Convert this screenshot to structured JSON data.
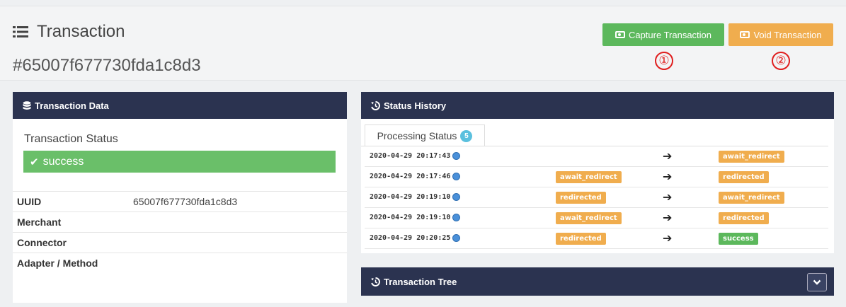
{
  "header": {
    "title": "Transaction",
    "transaction_id": "#65007f677730fda1c8d3",
    "capture_label": "Capture Transaction",
    "void_label": "Void Transaction",
    "marker_1": "①",
    "marker_2": "②"
  },
  "transaction_data": {
    "panel_title": "Transaction Data",
    "status_label": "Transaction Status",
    "status_value": "success",
    "fields": [
      {
        "key": "UUID",
        "value": "65007f677730fda1c8d3"
      },
      {
        "key": "Merchant",
        "value": ""
      },
      {
        "key": "Connector",
        "value": ""
      },
      {
        "key": "Adapter / Method",
        "value": ""
      }
    ]
  },
  "status_history": {
    "panel_title": "Status History",
    "tab_label": "Processing Status",
    "tab_count": "5",
    "rows": [
      {
        "time": "2020-04-29 20:17:43",
        "from": "",
        "to": "await_redirect"
      },
      {
        "time": "2020-04-29 20:17:46",
        "from": "await_redirect",
        "to": "redirected"
      },
      {
        "time": "2020-04-29 20:19:10",
        "from": "redirected",
        "to": "await_redirect"
      },
      {
        "time": "2020-04-29 20:19:10",
        "from": "await_redirect",
        "to": "redirected"
      },
      {
        "time": "2020-04-29 20:20:25",
        "from": "redirected",
        "to": "success"
      }
    ]
  },
  "transaction_tree": {
    "panel_title": "Transaction Tree"
  },
  "colors": {
    "header_dark": "#2b3350",
    "success": "#5cb85c",
    "warning": "#f0ad4e",
    "info": "#5bc0de"
  }
}
